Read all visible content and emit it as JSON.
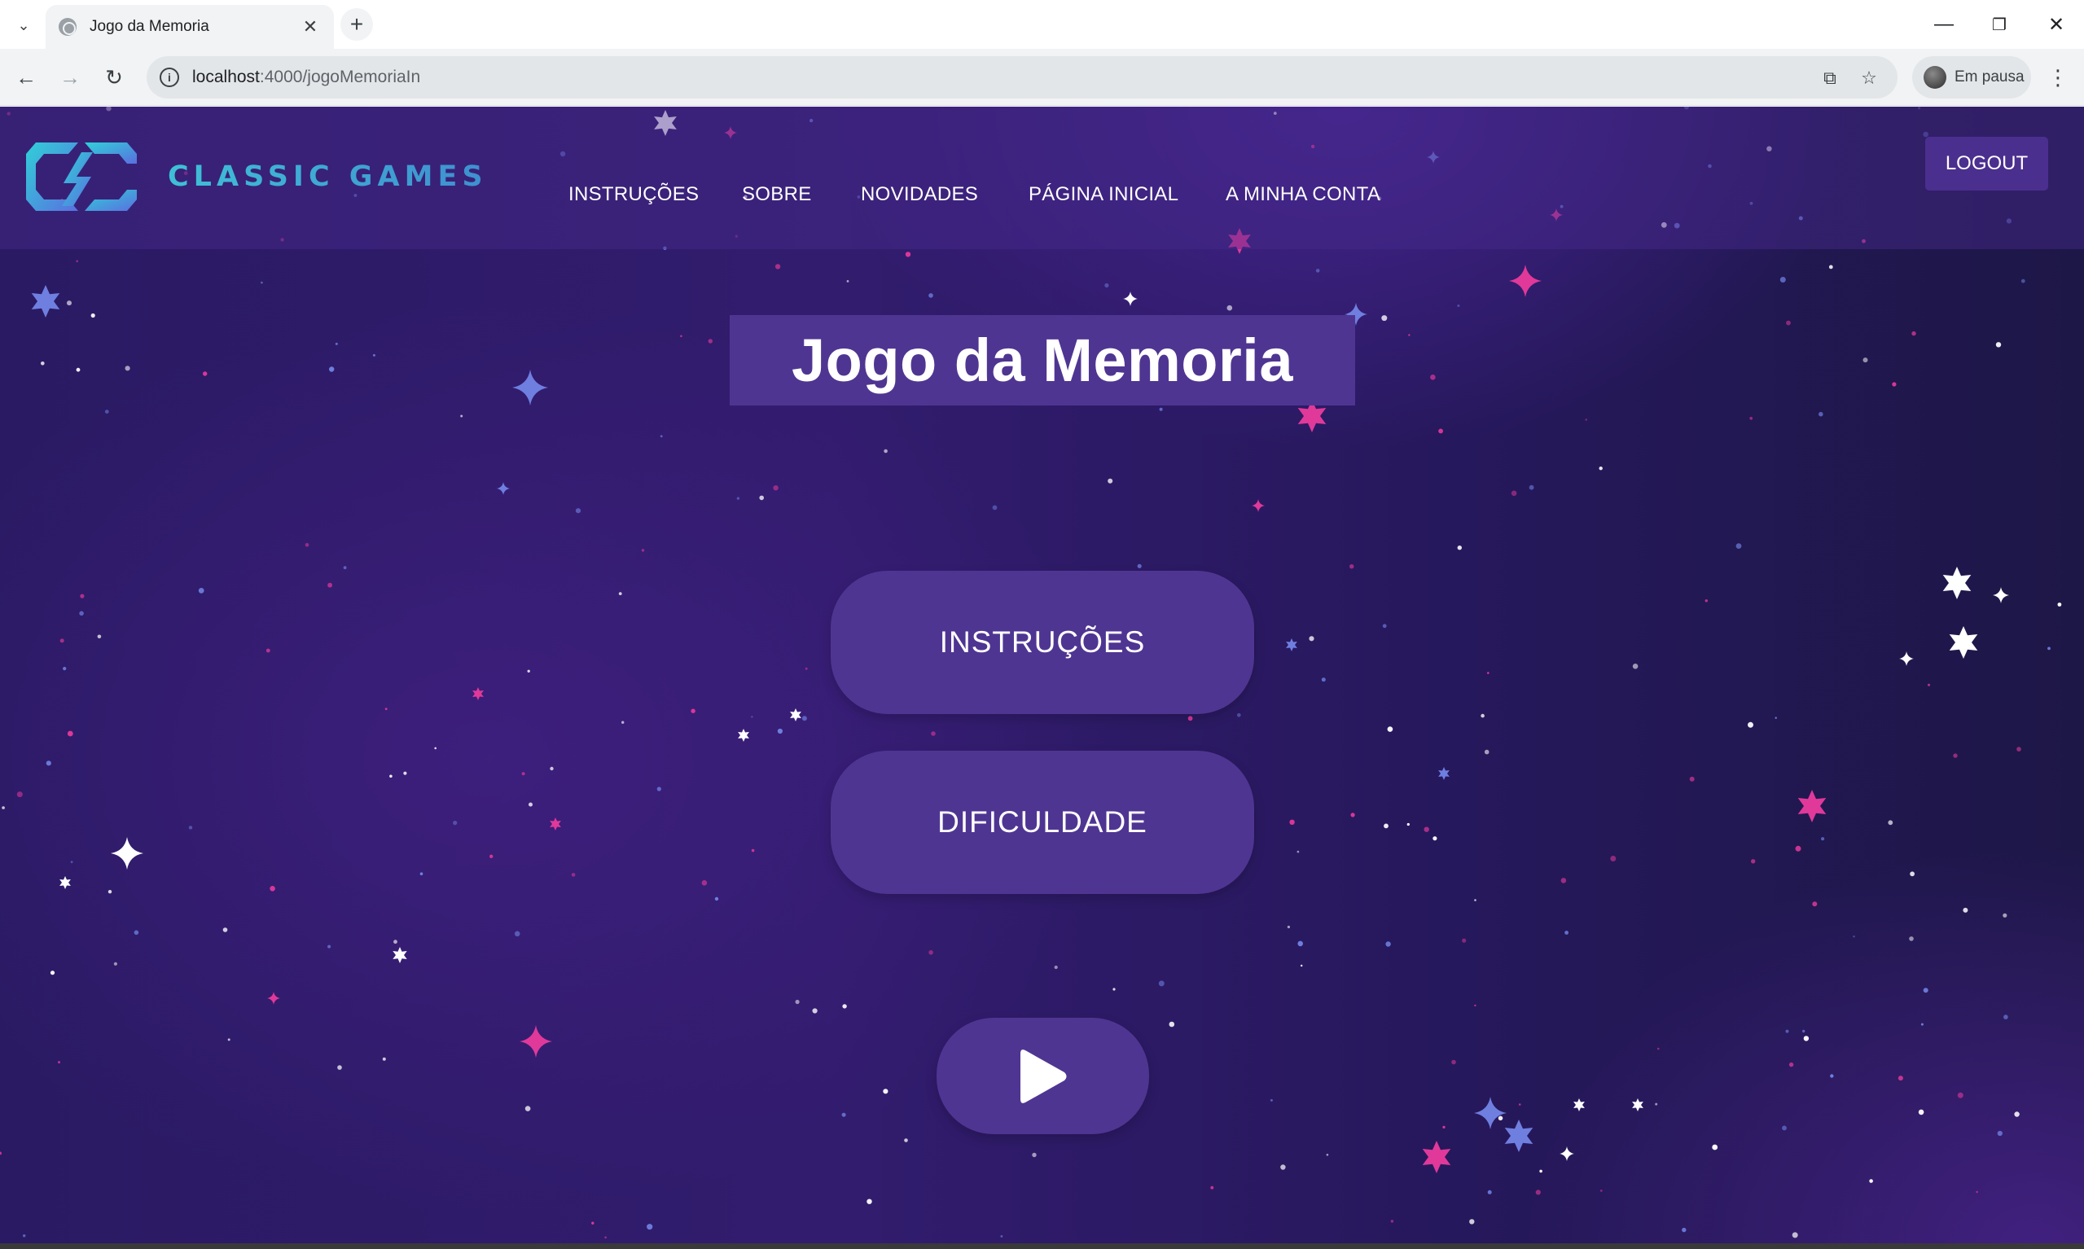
{
  "browser": {
    "tab_title": "Jogo da Memoria",
    "url_host": "localhost",
    "url_path": ":4000/jogoMemoriaIn",
    "profile_label": "Em pausa"
  },
  "site": {
    "brand": "CLASSIC GAMES",
    "nav": [
      {
        "label": "INSTRUÇÕES"
      },
      {
        "label": "SOBRE"
      },
      {
        "label": "NOVIDADES"
      },
      {
        "label": "PÁGINA INICIAL"
      },
      {
        "label": "A MINHA CONTA"
      }
    ],
    "logout_label": "LOGOUT"
  },
  "main": {
    "title": "Jogo da Memoria",
    "instructions_label": "INSTRUÇÕES",
    "difficulty_label": "DIFICULDADE",
    "play_icon": "play-icon"
  },
  "colors": {
    "panel": "#4f3592",
    "background": "#2a1a63",
    "star_pink": "#e0399a",
    "star_blue": "#6f7fe0",
    "star_white": "#ffffff",
    "logo_cyan": "#3fc0d6"
  }
}
